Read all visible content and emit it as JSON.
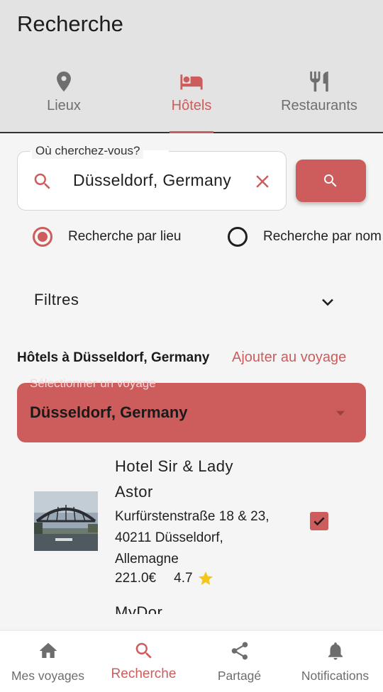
{
  "app": {
    "title": "Recherche"
  },
  "tabs": [
    {
      "label": "Lieux",
      "icon": "location-pin-icon",
      "active": false
    },
    {
      "label": "Hôtels",
      "icon": "bed-icon",
      "active": true
    },
    {
      "label": "Restaurants",
      "icon": "fork-knife-icon",
      "active": false
    }
  ],
  "search": {
    "legend": "Où cherchez-vous?",
    "value": "Düsseldorf, Germany",
    "lead_icon": "search-icon",
    "clear_icon": "close-icon",
    "button_icon": "search-icon"
  },
  "search_mode": {
    "options": [
      {
        "label": "Recherche par lieu",
        "checked": true
      },
      {
        "label": "Recherche par nom",
        "checked": false
      }
    ]
  },
  "filters": {
    "label": "Filtres",
    "icon": "chevron-down-icon"
  },
  "results": {
    "title": "Hôtels à Düsseldorf, Germany",
    "add_link": "Ajouter au voyage"
  },
  "trip_select": {
    "label": "Sélectionner un voyage",
    "value": "Düsseldorf, Germany",
    "icon": "dropdown-arrow-icon"
  },
  "hotels": [
    {
      "name": "Hotel Sir & Lady Astor",
      "address": "Kurfürstenstraße 18 & 23, 40211 Düsseldorf, Allemagne",
      "price": "221.0€",
      "rating": "4.7",
      "rating_icon": "star-icon",
      "selected": true
    },
    {
      "name": "MyDor"
    }
  ],
  "bottom_nav": [
    {
      "label": "Mes voyages",
      "icon": "home-icon",
      "active": false
    },
    {
      "label": "Recherche",
      "icon": "search-icon",
      "active": true
    },
    {
      "label": "Partagé",
      "icon": "share-icon",
      "active": false
    },
    {
      "label": "Notifications",
      "icon": "bell-icon",
      "active": false
    }
  ],
  "colors": {
    "accent": "#cd5c5c",
    "appbar": "#e3e3e3",
    "background": "#f5f5f5",
    "star": "#f5c518"
  }
}
